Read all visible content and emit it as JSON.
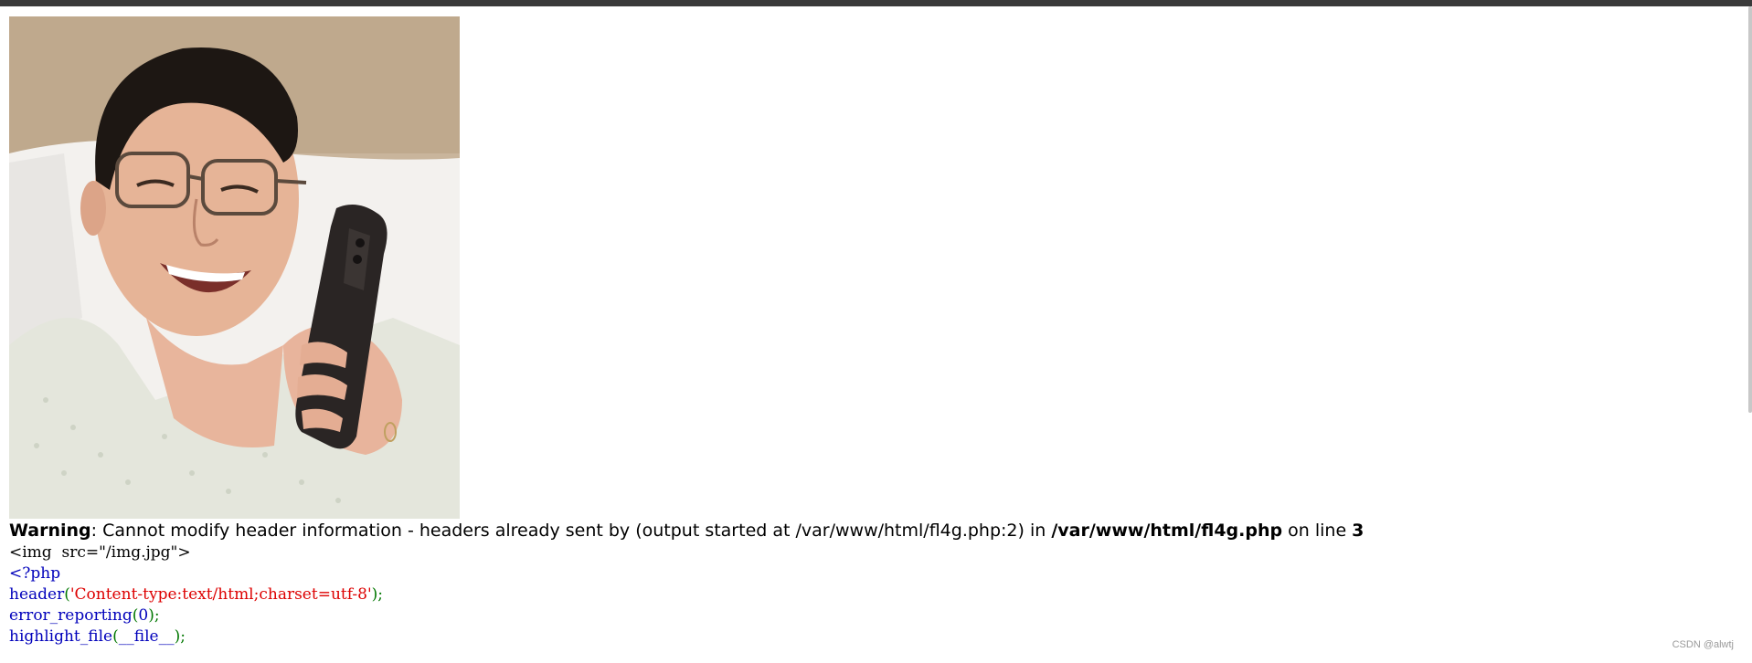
{
  "image": {
    "description_icon": "photo-of-man-with-phone"
  },
  "warning": {
    "label": "Warning",
    "message": ": Cannot modify header information - headers already sent by (output started at /var/www/html/fl4g.php:2) in ",
    "file": "/var/www/html/fl4g.php",
    "on_line": " on line ",
    "line": "3"
  },
  "source": {
    "line1": "<img  src=\"/img.jpg\">",
    "line2": "<?php",
    "line3_fn": "header",
    "line3_open": "(",
    "line3_str": "'Content-type:text/html;charset=utf-8'",
    "line3_close": ");",
    "line4_fn": "error_reporting",
    "line4_open": "(",
    "line4_arg": "0",
    "line4_close": ");",
    "line5_fn": "highlight_file",
    "line5_open": "(",
    "line5_arg": "__file__",
    "line5_close": ");"
  },
  "watermark": "CSDN @alwtj",
  "colors": {
    "keyword": "#0000bb",
    "string": "#dd0000",
    "punctuation": "#007700"
  }
}
